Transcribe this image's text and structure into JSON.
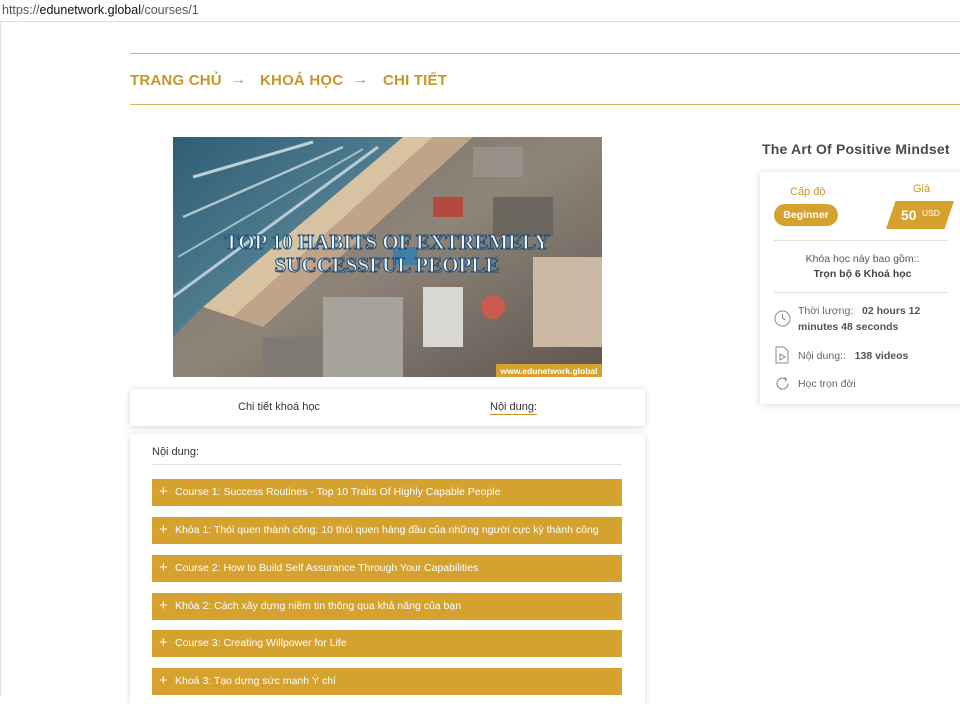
{
  "browser": {
    "url_prefix": "https://",
    "url_host": "edunetwork.global",
    "url_path": "/courses/1"
  },
  "breadcrumb": {
    "home": "TRANG CHỦ",
    "courses": "KHOÁ HỌC",
    "detail": "CHI TIẾT",
    "separator": "→"
  },
  "banner": {
    "title_line1": "TOP 10 HABITS OF EXTREMELY",
    "title_line2": "SUCCESSFUL PEOPLE",
    "watermark": "www.edunetwork.global"
  },
  "tabs": [
    {
      "label": "Chi tiết khoá học",
      "active": false
    },
    {
      "label": "Nội dung:",
      "active": true
    }
  ],
  "content": {
    "heading": "Nội dung:",
    "lessons": [
      "Course 1: Success Routines - Top 10 Traits Of Highly Capable People",
      "Khóa 1: Thói quen thành công: 10 thói quen hàng đầu của những người cực kỳ thành công",
      "Course 2: How to Build Self Assurance Through Your Capabilities",
      "Khóa 2: Cách xây dựng niềm tin thông qua khả năng của bạn",
      "Course 3: Creating Willpower for Life",
      "Khoá 3: Tạo dựng sức mạnh Ý chí"
    ]
  },
  "sidebar": {
    "course_title": "The Art Of Positive Mindset",
    "level_label": "Cấp độ",
    "level_value": "Beginner",
    "price_label": "Giá",
    "price_value": "50",
    "price_currency": "USD",
    "includes_label": "Khóa học này bao gồm::",
    "includes_value": "Trọn bộ 6 Khoá học",
    "duration_label": "Thời lượng:",
    "duration_value_1": "02 hours 12",
    "duration_value_2": "minutes 48 seconds",
    "content_label": "Nội dung::",
    "content_value": "138 videos",
    "lifetime_label": "Học trọn đời"
  },
  "colors": {
    "accent": "#d6a22f",
    "breadcrumb": "#c7962b"
  }
}
